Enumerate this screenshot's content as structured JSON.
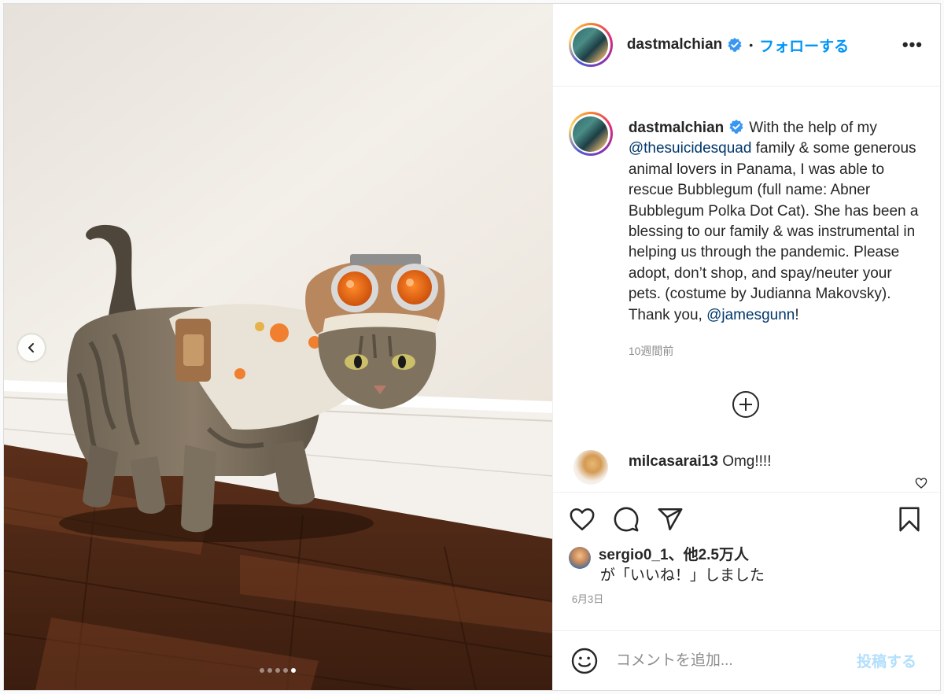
{
  "post": {
    "username": "dastmalchian",
    "follow_label": "フォローする",
    "separator": "•",
    "more_label": "•••"
  },
  "caption": {
    "username": "dastmalchian",
    "text_part1": "With the help of my ",
    "mention1": "@thesuicidesquad",
    "text_part2": " family & some generous animal lovers in Panama, I was able to rescue Bubblegum (full name: Abner Bubblegum Polka Dot Cat). She has been a blessing to our family & was instrumental in helping us through the pandemic. Please adopt, don’t shop, and spay/neuter your pets. (costume by Judianna Makovsky). Thank you, ",
    "mention2": "@jamesgunn",
    "text_part3": "!",
    "time_ago": "10週間前"
  },
  "comments": [
    {
      "username": "milcasarai13",
      "text": "Omg!!!!"
    }
  ],
  "likes": {
    "liker": "sergio0_1",
    "others": "、他2.5万人",
    "suffix": "が「いいね！」しました"
  },
  "date": "6月3日",
  "add_comment": {
    "placeholder": "コメントを追加...",
    "post_label": "投稿する"
  },
  "carousel": {
    "slide_count": 5,
    "active_index": 4
  },
  "colors": {
    "accent": "#0095f6",
    "mention": "#00376b",
    "post_disabled": "#b2dffc",
    "muted": "#8e8e8e"
  }
}
